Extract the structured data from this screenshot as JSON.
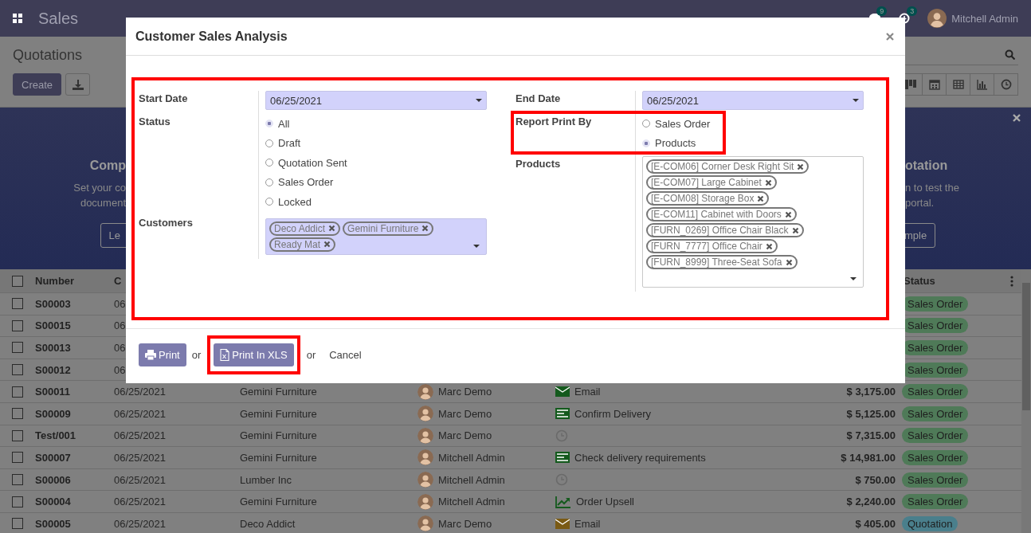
{
  "navbar": {
    "app_name": "Sales",
    "messages_count": "9",
    "activities_count": "3",
    "user_name": "Mitchell Admin"
  },
  "control_panel": {
    "title": "Quotations",
    "create_button": "Create"
  },
  "banner": {
    "left": {
      "title": "Comp",
      "lines": [
        "Set your co",
        "document"
      ],
      "button": "Le"
    },
    "right": {
      "title": "otation",
      "lines": [
        "n to test the",
        "portal."
      ],
      "button": "mple"
    }
  },
  "table": {
    "all_checked": false,
    "columns": {
      "number": "Number",
      "column_2": "C",
      "status": "Status"
    },
    "rows": [
      {
        "checked": false,
        "number": "S00003",
        "date": "06",
        "status": {
          "label": "Sales Order",
          "color": "#4f7a58"
        }
      },
      {
        "checked": false,
        "number": "S00015",
        "date": "06",
        "status": {
          "label": "Sales Order",
          "color": "#4f7a58"
        }
      },
      {
        "checked": false,
        "number": "S00013",
        "date": "06",
        "status": {
          "label": "Sales Order",
          "color": "#4f7a58"
        }
      },
      {
        "checked": false,
        "number": "S00012",
        "date": "06",
        "status": {
          "label": "Sales Order",
          "color": "#4f7a58"
        }
      },
      {
        "checked": false,
        "number": "S00011",
        "date": "06/25/2021",
        "customer": "Gemini Furniture",
        "salesperson": "Marc Demo",
        "activity": {
          "kind": "email",
          "label": "Email",
          "color": "#145a1d"
        },
        "total": "$ 3,175.00",
        "status": {
          "label": "Sales Order",
          "color": "#4f7a58"
        }
      },
      {
        "checked": false,
        "number": "S00009",
        "date": "06/25/2021",
        "customer": "Gemini Furniture",
        "salesperson": "Marc Demo",
        "activity": {
          "kind": "list",
          "label": "Confirm Delivery",
          "color": "#145a1d"
        },
        "total": "$ 5,125.00",
        "status": {
          "label": "Sales Order",
          "color": "#4f7a58"
        }
      },
      {
        "checked": false,
        "number": "Test/001",
        "date": "06/25/2021",
        "customer": "Gemini Furniture",
        "salesperson": "Marc Demo",
        "activity": {
          "kind": "clock",
          "color": "#6a6a6a"
        },
        "total": "$ 7,315.00",
        "status": {
          "label": "Sales Order",
          "color": "#4f7a58"
        }
      },
      {
        "checked": false,
        "number": "S00007",
        "date": "06/25/2021",
        "customer": "Gemini Furniture",
        "salesperson": "Mitchell Admin",
        "activity": {
          "kind": "list",
          "label": "Check delivery requirements",
          "color": "#145a1d"
        },
        "total": "$ 14,981.00",
        "status": {
          "label": "Sales Order",
          "color": "#4f7a58"
        }
      },
      {
        "checked": false,
        "number": "S00006",
        "date": "06/25/2021",
        "customer": "Lumber Inc",
        "salesperson": "Mitchell Admin",
        "activity": {
          "kind": "clock",
          "color": "#6a6a6a"
        },
        "total": "$ 750.00",
        "status": {
          "label": "Sales Order",
          "color": "#4f7a58"
        }
      },
      {
        "checked": false,
        "number": "S00004",
        "date": "06/25/2021",
        "customer": "Gemini Furniture",
        "salesperson": "Mitchell Admin",
        "activity": {
          "kind": "chart",
          "label": "Order Upsell",
          "color": "#145a1d"
        },
        "total": "$ 2,240.00",
        "status": {
          "label": "Sales Order",
          "color": "#4f7a58"
        }
      },
      {
        "checked": false,
        "number": "S00005",
        "date": "06/25/2021",
        "customer": "Deco Addict",
        "salesperson": "Marc Demo",
        "activity": {
          "kind": "email",
          "label": "Email",
          "color": "#7a5a14"
        },
        "total": "$ 405.00",
        "status": {
          "label": "Quotation",
          "color": "#4a7f8c"
        }
      }
    ]
  },
  "dialog": {
    "title": "Customer Sales Analysis",
    "start_date": {
      "label": "Start Date",
      "value": "06/25/2021"
    },
    "status": {
      "label": "Status",
      "options": [
        {
          "label": "All",
          "selected": true
        },
        {
          "label": "Draft",
          "selected": false
        },
        {
          "label": "Quotation Sent",
          "selected": false
        },
        {
          "label": "Sales Order",
          "selected": false
        },
        {
          "label": "Locked",
          "selected": false
        }
      ]
    },
    "customers": {
      "label": "Customers",
      "tags": [
        "Deco Addict",
        "Gemini Furniture",
        "Ready Mat"
      ]
    },
    "end_date": {
      "label": "End Date",
      "value": "06/25/2021"
    },
    "report_print_by": {
      "label": "Report Print By",
      "highlighted": true,
      "options": [
        {
          "label": "Sales Order",
          "selected": false
        },
        {
          "label": "Products",
          "selected": true
        }
      ]
    },
    "products": {
      "label": "Products",
      "tags": [
        "[E-COM06] Corner Desk Right Sit",
        "[E-COM07] Large Cabinet",
        "[E-COM08] Storage Box",
        "[E-COM11] Cabinet with Doors",
        "[FURN_0269] Office Chair Black",
        "[FURN_7777] Office Chair",
        "[FURN_8999] Three-Seat Sofa"
      ]
    },
    "footer": [
      {
        "kind": "print",
        "label": "Print",
        "highlighted": false
      },
      {
        "kind": "text",
        "label": "or"
      },
      {
        "kind": "xls",
        "label": "Print In XLS",
        "highlighted": true
      },
      {
        "kind": "text",
        "label": "or"
      },
      {
        "kind": "link",
        "label": "Cancel"
      }
    ]
  }
}
